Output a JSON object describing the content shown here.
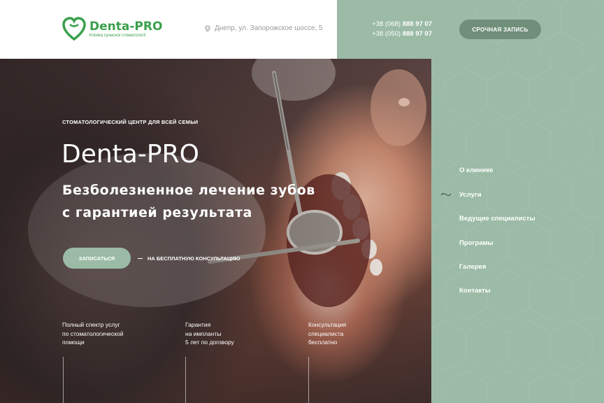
{
  "header": {
    "logo": {
      "name": "Denta-PRO",
      "tagline": "Клініка сучасної стоматології"
    },
    "address": "Днепр, ул. Запорожское шоссе, 5",
    "phones": [
      {
        "prefix": "+38 (068) ",
        "number": "888 97 07"
      },
      {
        "prefix": "+38 (050) ",
        "number": "888 97 07"
      }
    ],
    "urgent_button": "СРОЧНАЯ ЗАПИСЬ"
  },
  "hero": {
    "eyebrow": "СТОМАТОЛОГИЧЕСКИЙ ЦЕНТР ДЛЯ ВСЕЙ СЕМЬИ",
    "title": "Denta-PRO",
    "subtitle_line1": "Безболезненное лечение зубов",
    "subtitle_line2": "с гарантией результата",
    "signup_button": "ЗАПИСАТЬСЯ",
    "consult_link": "НА БЕСПЛАТНУЮ КОНСУЛЬТАЦИЮ",
    "features": [
      {
        "line1": "Полный спектр услуг",
        "line2": "по стоматологической",
        "line3": "помощи"
      },
      {
        "line1": "Гарантия",
        "line2": "на импланты",
        "line3": "5 лет по договору"
      },
      {
        "line1": "Консультация",
        "line2": "специалиста",
        "line3": "бесплатно"
      }
    ]
  },
  "nav": {
    "items": [
      {
        "label": "О клинике"
      },
      {
        "label": "Услуги",
        "active": true
      },
      {
        "label": "Ведущие специалисты"
      },
      {
        "label": "Програмы"
      },
      {
        "label": "Галерея"
      },
      {
        "label": "Контакты"
      }
    ]
  },
  "colors": {
    "accent": "#9bbba6",
    "button_dark": "#6f8f7a",
    "logo_green": "#3aa04c"
  }
}
